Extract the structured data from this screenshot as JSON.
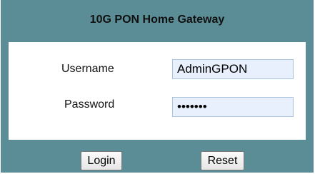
{
  "header": {
    "title": "10G PON Home Gateway"
  },
  "form": {
    "username_label": "Username",
    "username_value": "AdminGPON",
    "password_label": "Password",
    "password_value": "1234567"
  },
  "buttons": {
    "login_label": "Login",
    "reset_label": "Reset"
  },
  "colors": {
    "panel": "#5b8d96",
    "input_background": "#e8f0fe",
    "form_background": "#ffffff"
  }
}
